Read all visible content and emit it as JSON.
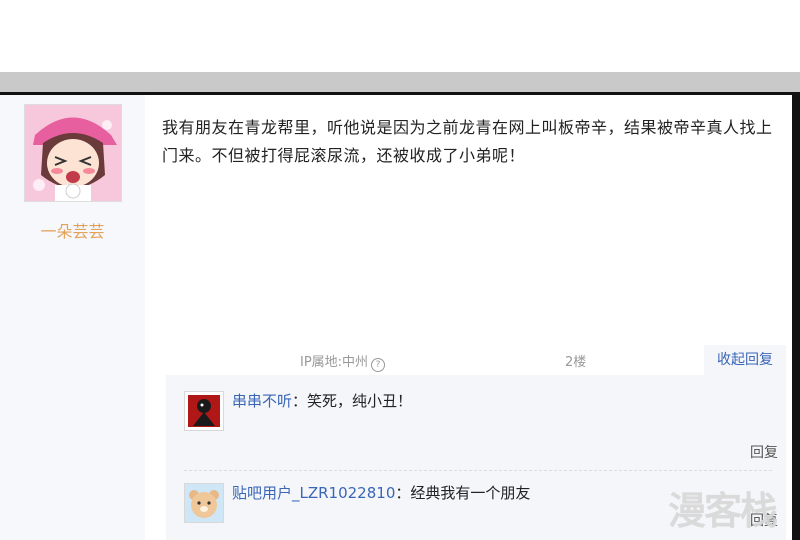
{
  "post": {
    "username": "一朵芸芸",
    "content": "我有朋友在青龙帮里，听他说是因为之前龙青在网上叫板帝辛，结果被帝辛真人找上门来。不但被打得屁滚尿流，还被收成了小弟呢！",
    "ip_location": "IP属地:中州",
    "floor": "2楼",
    "collapse_label": "收起回复"
  },
  "comments": [
    {
      "user": "串串不听",
      "sep": "：",
      "text": "笑死，纯小丑！",
      "reply_label": "回复"
    },
    {
      "user": "贴吧用户_LZR1022810",
      "sep": "：",
      "text": "经典我有一个朋友",
      "reply_label": "回复"
    }
  ],
  "watermark": "漫客栈"
}
